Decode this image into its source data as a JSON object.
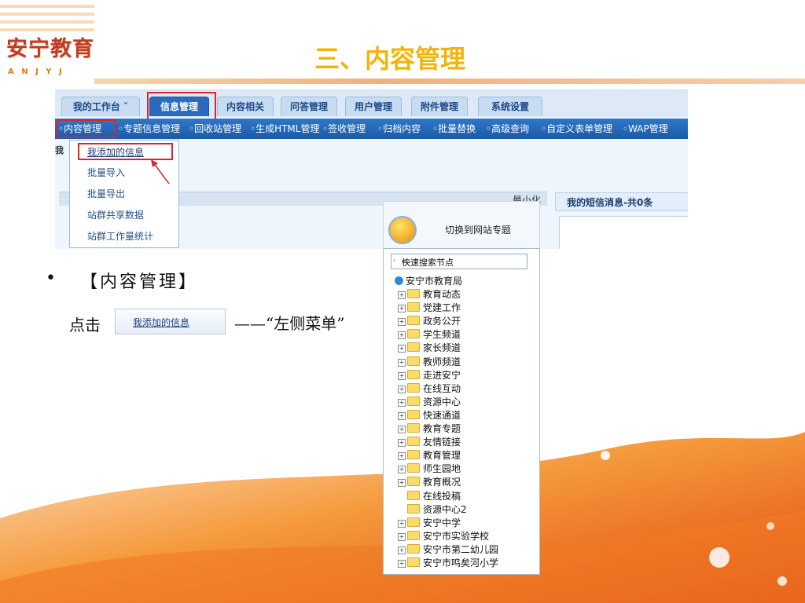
{
  "slide": {
    "title": "三、内容管理",
    "logo_main": "安宁教育",
    "logo_sub": "A N J Y J",
    "bullet_symbol": "•",
    "bullet_text": "【内容管理】",
    "click_text": "点击",
    "arrow_text": "——“左侧菜单”"
  },
  "screenshot": {
    "tabs": [
      "我的工作台 ˇ",
      "信息管理",
      "内容相关",
      "问答管理",
      "用户管理",
      "附件管理",
      "系统设置"
    ],
    "subnav": [
      "◦内容管理",
      "◦专题信息管理",
      "◦回收站管理",
      "◦生成HTML管理",
      "◦签收管理",
      "◦归档内容",
      "◦批量替换",
      "◦高级查询",
      "◦自定义表单管理",
      "◦WAP管理"
    ],
    "left_label": "我",
    "dropdown": [
      "我添加的信息",
      "批量导入",
      "批量导出",
      "站群共享数据",
      "站群工作量统计"
    ],
    "minimize_label": "最小化",
    "msg_title": "我的短信消息-共0条"
  },
  "button_image_label": "我添加的信息",
  "tree": {
    "switch_label": "切换到网站专题",
    "search_placeholder": "快速搜索节点",
    "root": "安宁市教育局",
    "nodes": [
      "教育动态",
      "党建工作",
      "政务公开",
      "学生频道",
      "家长频道",
      "教师频道",
      "走进安宁",
      "在线互动",
      "资源中心",
      "快速通道",
      "教育专题",
      "友情链接",
      "教育管理",
      "师生园地",
      "教育概况",
      "在线投稿",
      "资源中心2",
      "安宁中学",
      "安宁市实验学校",
      "安宁市第二幼儿园",
      "安宁市鸣矣河小学"
    ],
    "expandable": [
      true,
      true,
      true,
      true,
      true,
      true,
      true,
      true,
      true,
      true,
      true,
      true,
      true,
      true,
      true,
      false,
      false,
      true,
      true,
      true,
      true
    ]
  },
  "colors": {
    "title": "#f3b409",
    "highlight": "#d8262e",
    "nav_blue": "#1d5aa8",
    "folder": "#fcdb6a"
  }
}
